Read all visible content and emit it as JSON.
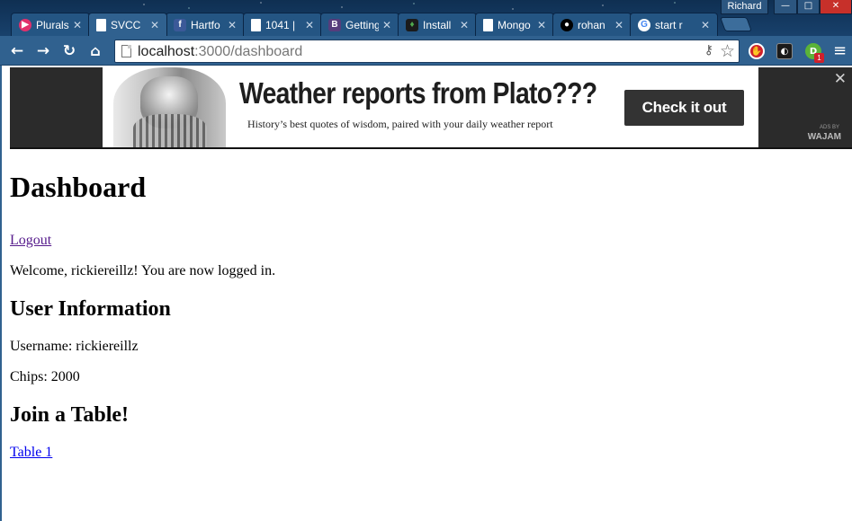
{
  "window": {
    "profile_name": "Richard",
    "minimize_glyph": "—",
    "maximize_glyph": "□",
    "close_glyph": "✕"
  },
  "tabs": [
    {
      "label": "Plurals",
      "icon": "pluralsight-icon",
      "color": "#e1306c",
      "active": false
    },
    {
      "label": "SVCC",
      "icon": "document-icon",
      "color": "#ffffff",
      "active": true
    },
    {
      "label": "Hartfo",
      "icon": "facebook-icon",
      "color": "#3b5998",
      "active": false
    },
    {
      "label": "1041 |",
      "icon": "document-icon",
      "color": "#ffffff",
      "active": false
    },
    {
      "label": "Getting",
      "icon": "bootstrap-icon",
      "color": "#563d7c",
      "active": false
    },
    {
      "label": "Install",
      "icon": "mongodb-leaf-icon",
      "color": "#4fa94d",
      "active": false
    },
    {
      "label": "Mongo",
      "icon": "document-icon",
      "color": "#ffffff",
      "active": false
    },
    {
      "label": "rohan",
      "icon": "github-icon",
      "color": "#000000",
      "active": false
    },
    {
      "label": "start r",
      "icon": "google-icon",
      "color": "#4285f4",
      "active": false
    }
  ],
  "toolbar": {
    "url_host": "localhost",
    "url_rest": ":3000/dashboard"
  },
  "ad": {
    "headline": "Weather reports from Plato???",
    "subtext": "History’s best quotes of wisdom, paired with your daily weather report",
    "cta": "Check it out",
    "close": "✕",
    "brand_small": "ADS BY",
    "brand_big": "WAJAM"
  },
  "page": {
    "title": "Dashboard",
    "logout": "Logout",
    "welcome": "Welcome, rickiereillz! You are now logged in.",
    "user_info_heading": "User Information",
    "username_line": "Username: rickiereillz",
    "chips_line": "Chips: 2000",
    "join_heading": "Join a Table!",
    "table_link": "Table 1"
  }
}
